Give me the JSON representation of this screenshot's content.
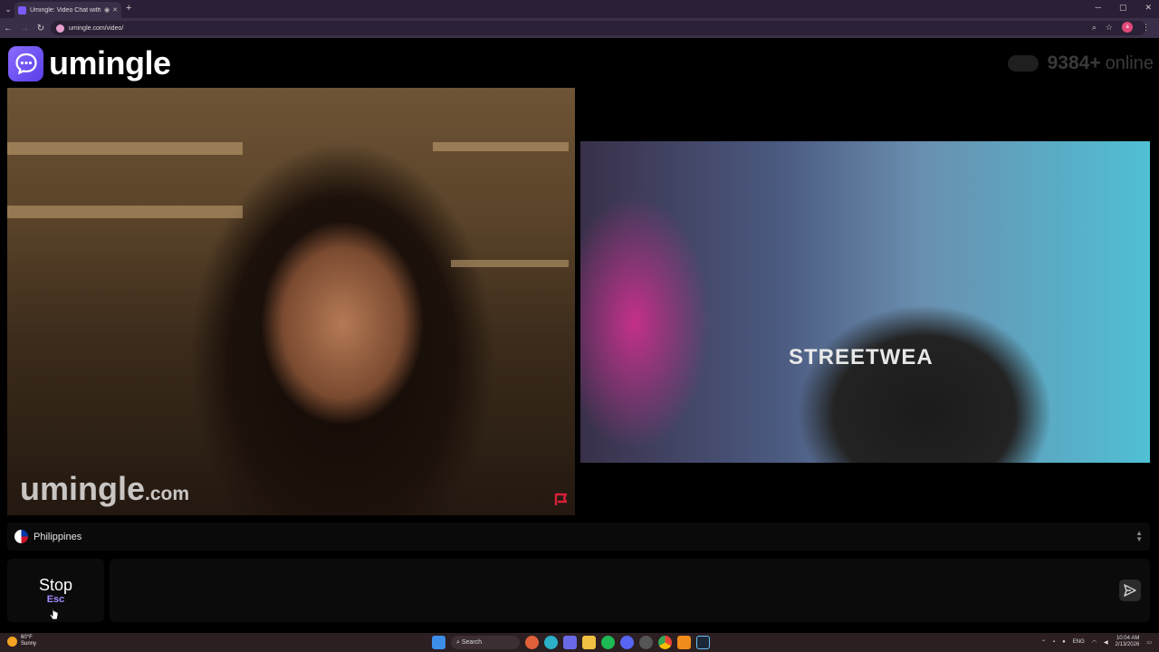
{
  "browser": {
    "tab_title": "Umingle: Video Chat with S",
    "url": "umingle.com/video/",
    "new_tab": "+",
    "menu_glyph": "⌄",
    "tab_icons": [
      "record-icon",
      "close-icon"
    ],
    "window_controls": [
      "minimize-icon",
      "restore-icon",
      "close-icon"
    ],
    "nav": [
      "back-icon",
      "forward-icon",
      "reload-icon"
    ],
    "addr_icons": [
      "zoom-icon",
      "bookmark-star-icon"
    ],
    "profile_initial": "a"
  },
  "site": {
    "logo_text": "umingle",
    "logo_icon": "chat-bubble-icon",
    "online_count": "9384+",
    "online_label": "online",
    "accent": "#7b5cff"
  },
  "stranger": {
    "watermark": "umingle",
    "watermark_suffix": ".com",
    "report_icon": "flag-icon",
    "report_color": "#d8203a"
  },
  "self": {
    "hoodie_text": "STREETWEA"
  },
  "country": {
    "name": "Philippines",
    "flag_icon": "philippines-flag-icon"
  },
  "controls": {
    "stop_label": "Stop",
    "stop_key": "Esc",
    "chat_placeholder": "",
    "send_icon": "send-icon"
  },
  "taskbar": {
    "weather_temp": "60°F",
    "weather_desc": "Sunny",
    "search_label": "Search",
    "lang": "ENG",
    "time": "10:04 AM",
    "date": "2/13/2026"
  }
}
